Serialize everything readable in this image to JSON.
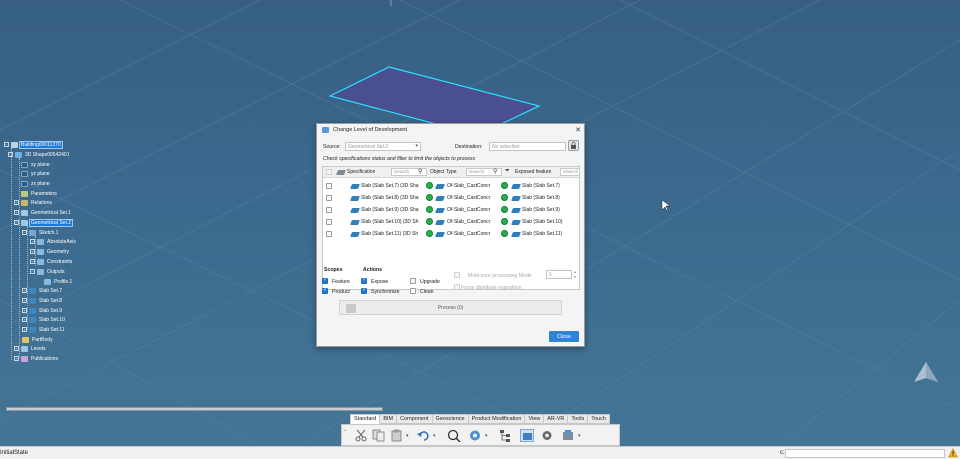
{
  "tree": {
    "items": [
      {
        "label": "Building00011370",
        "selected": true
      },
      {
        "label": "3D Shape00542401",
        "selected": false
      },
      {
        "label": "xy plane",
        "selected": false
      },
      {
        "label": "yz plane",
        "selected": false
      },
      {
        "label": "zx plane",
        "selected": false
      },
      {
        "label": "Parameters",
        "selected": false
      },
      {
        "label": "Relations",
        "selected": false
      },
      {
        "label": "Geometrical Set.1",
        "selected": false
      },
      {
        "label": "Geometrical Set.2",
        "selected": true
      },
      {
        "label": "Sketch.1",
        "selected": false
      },
      {
        "label": "AbsoluteAxis",
        "selected": false
      },
      {
        "label": "Geometry",
        "selected": false
      },
      {
        "label": "Constraints",
        "selected": false
      },
      {
        "label": "Outputs",
        "selected": false
      },
      {
        "label": "Profile.1",
        "selected": false
      },
      {
        "label": "Slab Set.7",
        "selected": false
      },
      {
        "label": "Slab Set.8",
        "selected": false
      },
      {
        "label": "Slab Set.9",
        "selected": false
      },
      {
        "label": "Slab Set.10",
        "selected": false
      },
      {
        "label": "Slab Set.11",
        "selected": false
      },
      {
        "label": "PartBody",
        "selected": false
      },
      {
        "label": "Levels",
        "selected": false
      },
      {
        "label": "Publications",
        "selected": false
      }
    ]
  },
  "dialog": {
    "title": "Change Level of Development",
    "source_label": "Source:",
    "source_value": "Geometrical Set.2",
    "destination_label": "Destination:",
    "destination_placeholder": "No selection",
    "hint": "Check specifications status and filter to limit the objects to process",
    "columns": {
      "specification": "Specification",
      "object_type": "Object Type",
      "exposed_feature": "Exposed feature",
      "search_placeholder": "Search"
    },
    "rows": [
      {
        "spec": "Slab (Slab Set.7) (3D Sha",
        "type": "Of-Slab_CastConcr",
        "exposed": "Slab (Slab Set.7)"
      },
      {
        "spec": "Slab (Slab Set.8) (3D Sha",
        "type": "Of-Slab_CastConcr",
        "exposed": "Slab (Slab Set.8)"
      },
      {
        "spec": "Slab (Slab Set.9) (3D Sha",
        "type": "Of-Slab_CastConcr",
        "exposed": "Slab (Slab Set.9)"
      },
      {
        "spec": "Slab (Slab Set.10) (3D Sh",
        "type": "Of-Slab_CastConcr",
        "exposed": "Slab (Slab Set.10)"
      },
      {
        "spec": "Slab (Slab Set.11) (3D Sh",
        "type": "Of-Slab_CastConcr",
        "exposed": "Slab (Slab Set.11)"
      }
    ],
    "scopes_label": "Scopes",
    "actions_label": "Actions",
    "feature_label": "Feature",
    "product_label": "Product",
    "expose_label": "Expose",
    "synchronize_label": "Synchronize",
    "upgrade_label": "Upgrade",
    "clean_label": "Clean",
    "multicore_label": "Multi-core processing Mode",
    "multicore_value": "6",
    "force_label": "Force distribute exposition",
    "process_label": "Process (0)",
    "close_label": "Close"
  },
  "toolbar": {
    "tabs": [
      {
        "label": "Standard",
        "active": true
      },
      {
        "label": "BIM",
        "active": false
      },
      {
        "label": "Component",
        "active": false
      },
      {
        "label": "Geoscience",
        "active": false
      },
      {
        "label": "Product Modification",
        "active": false
      },
      {
        "label": "View",
        "active": false
      },
      {
        "label": "AR-VR",
        "active": false
      },
      {
        "label": "Tools",
        "active": false
      },
      {
        "label": "Touch",
        "active": false
      }
    ],
    "tools": [
      "cut-icon",
      "copy-icon",
      "paste-icon",
      "undo-icon",
      "zoom-icon",
      "update-icon",
      "tree-icon",
      "select-icon",
      "settings-icon",
      "assembly-icon"
    ]
  },
  "status": {
    "text": "InitialState",
    "command_prefix": "c:"
  },
  "colors": {
    "accent": "#2f84d6",
    "ok": "#22b24c",
    "viewport": "#3c6a8e"
  }
}
